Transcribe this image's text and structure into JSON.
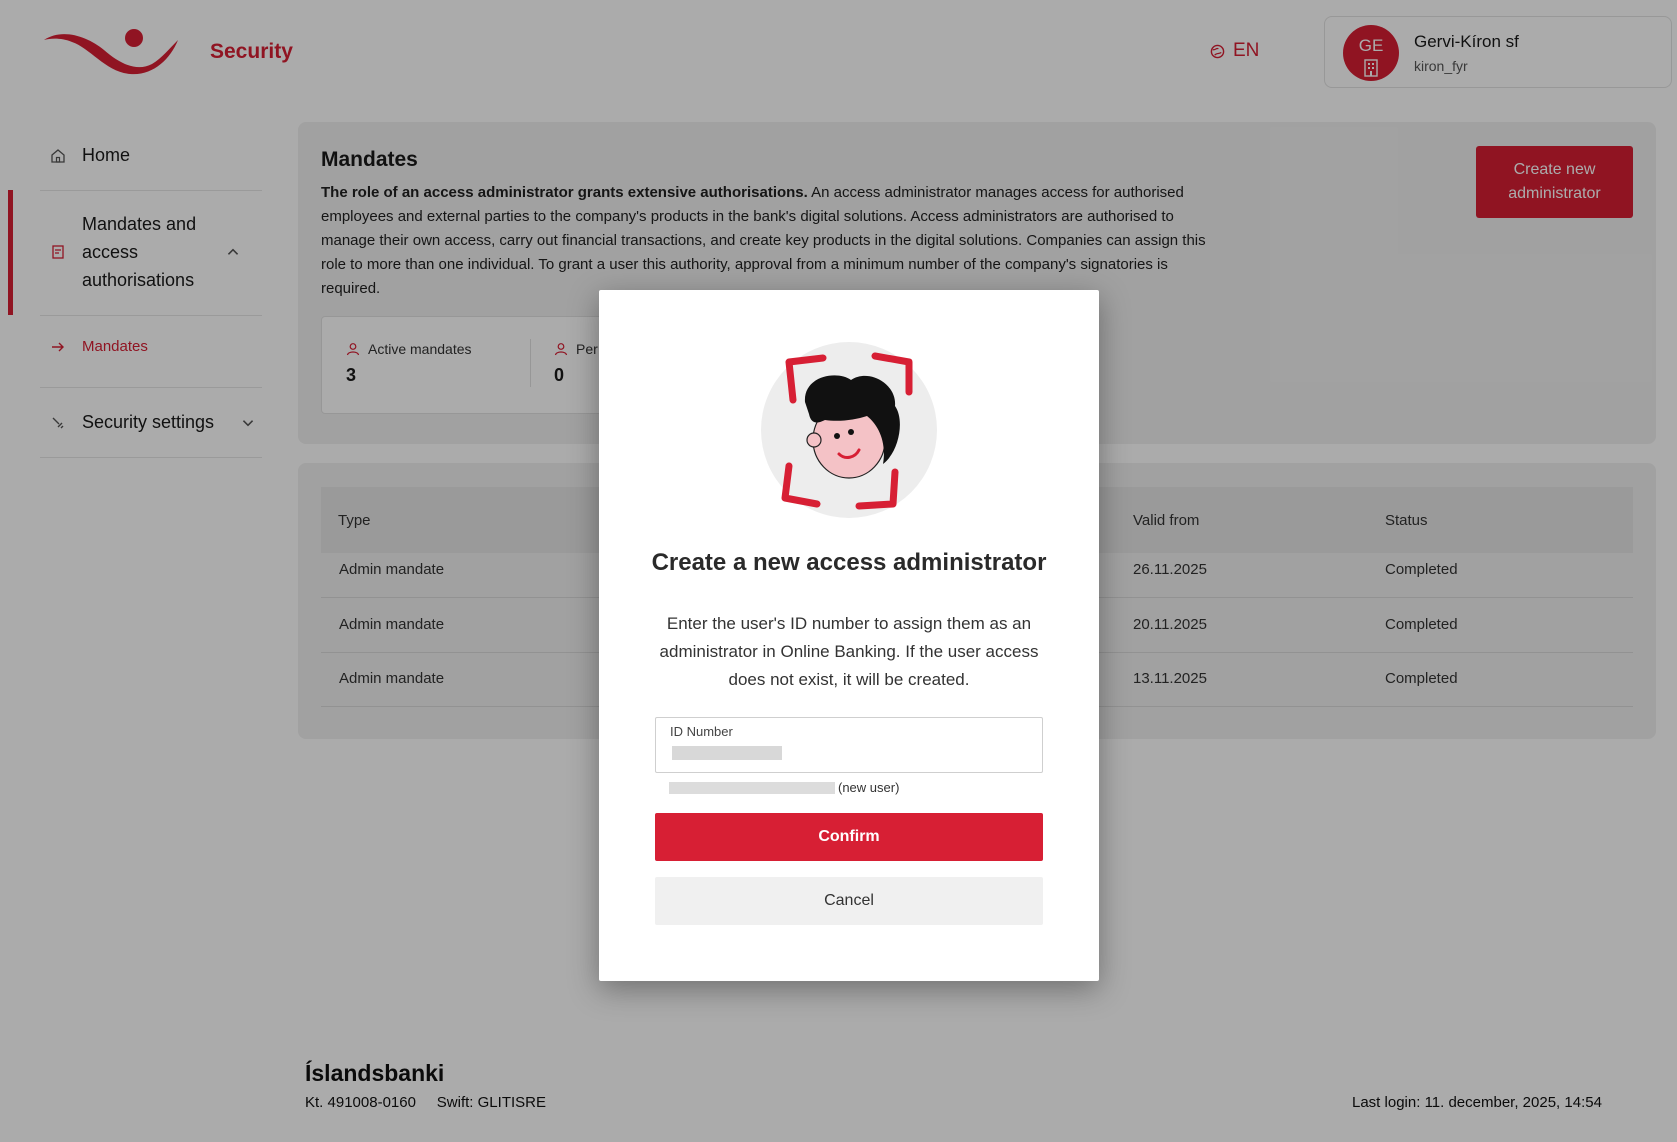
{
  "header": {
    "app_title": "Security",
    "language": "EN",
    "user": {
      "initials": "GE",
      "name": "Gervi-Kíron sf",
      "username": "kiron_fyr"
    }
  },
  "sidebar": {
    "items": [
      {
        "label": "Home",
        "icon": "home-icon"
      },
      {
        "label": "Mandates and access authorisations",
        "icon": "document-icon",
        "expanded": true
      },
      {
        "label": "Mandates",
        "icon": "arrow-right-icon",
        "active": true
      },
      {
        "label": "Security settings",
        "icon": "wrench-icon",
        "expanded": false
      }
    ]
  },
  "main": {
    "title": "Mandates",
    "description_bold": "The role of an access administrator grants extensive authorisations.",
    "description_rest": " An access administrator manages access for authorised employees and external parties to the company's products in the bank's digital solutions. Access administrators are authorised to manage their own access, carry out financial transactions, and create key products in the digital solutions. Companies can assign this role to more than one individual. To grant a user this authority, approval from a minimum number of the company's signatories is required.",
    "create_button": "Create new administrator",
    "stats": [
      {
        "label": "Active mandates",
        "value": "3"
      },
      {
        "label": "Per",
        "value": "0"
      }
    ],
    "table": {
      "headers": [
        "Type",
        "Valid from",
        "Status"
      ],
      "rows": [
        [
          "Admin mandate",
          "26.11.2025",
          "Completed"
        ],
        [
          "Admin mandate",
          "20.11.2025",
          "Completed"
        ],
        [
          "Admin mandate",
          "13.11.2025",
          "Completed"
        ]
      ]
    }
  },
  "modal": {
    "title": "Create a new access administrator",
    "text": "Enter the user's ID number to assign them as an administrator in Online Banking. If the user access does not exist, it will be created.",
    "field_label": "ID Number",
    "hint_suffix": "(new user)",
    "confirm": "Confirm",
    "cancel": "Cancel"
  },
  "footer": {
    "bank": "Íslandsbanki",
    "kt_label": "Kt.",
    "kt_value": "491008-0160",
    "swift_label": "Swift:",
    "swift_value": "GLITISRE",
    "last_login_label": "Last login:",
    "last_login_value": "11. december, 2025, 14:54"
  },
  "colors": {
    "brand": "#d71f34",
    "overlay": "rgba(0,0,0,0.33)"
  }
}
